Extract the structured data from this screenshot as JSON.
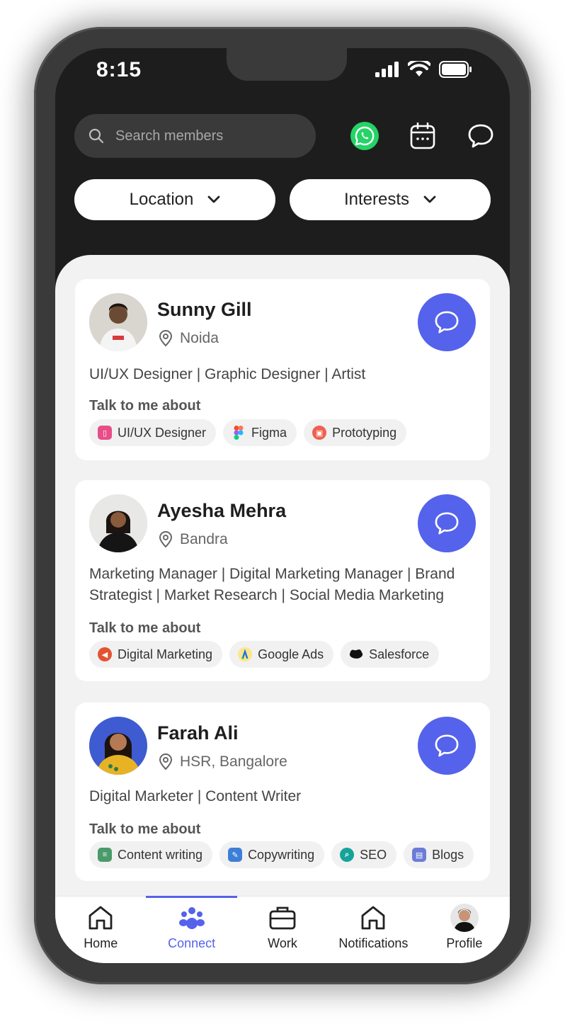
{
  "status": {
    "time": "8:15"
  },
  "search": {
    "placeholder": "Search members"
  },
  "header_icons": [
    "whatsapp-icon",
    "calendar-icon",
    "chat-icon"
  ],
  "filters": [
    {
      "label": "Location"
    },
    {
      "label": "Interests"
    }
  ],
  "members": [
    {
      "name": "Sunny Gill",
      "location": "Noida",
      "roles": "UI/UX Designer | Graphic Designer | Artist",
      "talk_label": "Talk to me about",
      "topics": [
        {
          "label": "UI/UX Designer",
          "icon": "phone-ui-icon",
          "color": "#e84d88"
        },
        {
          "label": "Figma",
          "icon": "figma-icon",
          "color": "#a259ff"
        },
        {
          "label": "Prototyping",
          "icon": "prototype-icon",
          "color": "#ef5f4f"
        }
      ]
    },
    {
      "name": "Ayesha Mehra",
      "location": "Bandra",
      "roles": "Marketing Manager | Digital Marketing Manager | Brand Strategist | Market Research | Social Media Marketing",
      "talk_label": "Talk to me about",
      "topics": [
        {
          "label": "Digital Marketing",
          "icon": "megaphone-icon",
          "color": "#e4532f"
        },
        {
          "label": "Google Ads",
          "icon": "google-ads-icon",
          "color": "#f4b400"
        },
        {
          "label": "Salesforce",
          "icon": "salesforce-icon",
          "color": "#111111"
        }
      ]
    },
    {
      "name": "Farah Ali",
      "location": "HSR, Bangalore",
      "roles": "Digital Marketer | Content Writer",
      "talk_label": "Talk to me about",
      "topics": [
        {
          "label": "Content writing",
          "icon": "content-icon",
          "color": "#4a9a6a"
        },
        {
          "label": "Copywriting",
          "icon": "copywriting-icon",
          "color": "#3d7fd6"
        },
        {
          "label": "SEO",
          "icon": "seo-icon",
          "color": "#16a39a"
        },
        {
          "label": "Blogs",
          "icon": "blog-icon",
          "color": "#6b7bd8"
        }
      ]
    }
  ],
  "tabs": [
    {
      "label": "Home",
      "icon": "home-icon"
    },
    {
      "label": "Connect",
      "icon": "people-icon",
      "active": true
    },
    {
      "label": "Work",
      "icon": "briefcase-icon"
    },
    {
      "label": "Notifications",
      "icon": "bell-house-icon"
    },
    {
      "label": "Profile",
      "icon": "profile-avatar"
    }
  ],
  "colors": {
    "accent": "#5562eb",
    "dark_bg": "#1d1d1d",
    "whatsapp": "#25d366"
  }
}
